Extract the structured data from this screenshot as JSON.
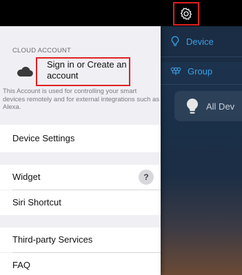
{
  "nav": {
    "device_label": "Device",
    "group_label": "Group",
    "all_devices_label": "All Dev"
  },
  "settings": {
    "section_header": "CLOUD ACCOUNT",
    "signin_label": "Sign in or Create an account",
    "account_description": "This Account is used for controlling your smart devices remotely and for external integrations such as Alexa.",
    "items": [
      {
        "label": "Device Settings"
      },
      {
        "label": "Widget",
        "badge": "?"
      },
      {
        "label": "Siri Shortcut"
      },
      {
        "label": "Third-party Services"
      },
      {
        "label": "FAQ"
      }
    ]
  },
  "icons": {
    "settings": "gear-icon",
    "device": "lightbulb-icon",
    "group": "group-icon",
    "all_devices": "lightbulb-icon",
    "account": "cloud-icon"
  },
  "colors": {
    "highlight": "#e02020",
    "accent": "#3aa0e8"
  }
}
